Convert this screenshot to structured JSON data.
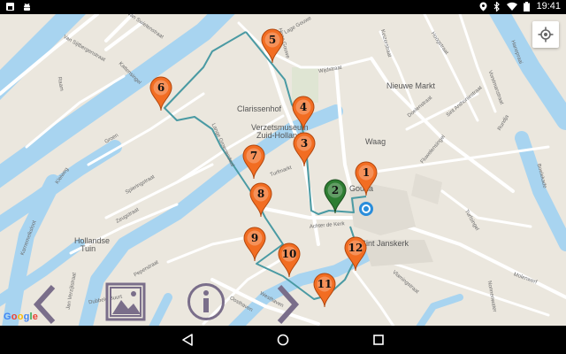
{
  "status_bar": {
    "time": "19:41",
    "icons": [
      "notification-icon",
      "android-icon",
      "location-icon",
      "bluetooth-icon",
      "wifi-icon",
      "battery-icon"
    ]
  },
  "map": {
    "labels": {
      "nieuwe_markt": "Nieuwe Markt",
      "clarissenhof": "Clarissenhof",
      "verzetsmuseum_1": "Verzetsmuseum",
      "verzetsmuseum_2": "Zuid-Holland",
      "waag": "Waag",
      "gouda": "Gouda",
      "sint_janskerk": "Sint Janskerk",
      "hollandse_1": "Hollandse",
      "hollandse_2": "Tuin",
      "van_swietenstraat": "Van Swietenstraat",
      "van_sijtbergenstraat": "Van Sijtbergenstraat",
      "kattensingel": "Kattensingel",
      "raam": "Raam",
      "groen": "Groen",
      "kleiweg": "Kleiweg",
      "lange_groenendaal": "Lange Groenendaal",
      "turfmarkt": "Turfmarkt",
      "hoge_gouwe": "Hoge Gouwe",
      "lage_gouwe": "Lage Gouwe",
      "achter_de_kerk": "Achter de Kerk",
      "spieringstraat": "Spieringstraat",
      "zeugstraat": "Zeugstraat",
      "peperstraat": "Peperstraat",
      "oosthaven": "Oosthaven",
      "westhaven": "Westhaven",
      "jan_verzijlstraat": "Jan Verzijlstraat",
      "dubbele_buurt": "Dubbele Buurt",
      "wijdstraat": "Wijdstraat",
      "regentesse": "Regentesseplantsoen",
      "walestraat": "Walestraat",
      "keizerstraat": "Keizerstraat",
      "hoogstraat": "Hoogstraat",
      "doelenstraat": "Doelenstraat",
      "sint_anthonie": "Sint Anthoniestraat",
      "vorstmanstraat": "Vorstmanstraat",
      "hanepraai": "Hanepraai",
      "boelekade": "Boelekade",
      "fluwelensingel": "Fluwelensingel",
      "turfsingel": "Turfsingel",
      "vlamingstraat": "Vlamingstraat",
      "nonnenwater": "Nonnenwater",
      "molenwerf": "Molenwerf",
      "karnemelksloot": "Karnemelksloot",
      "agnietenstraat": "Agnietenstraat",
      "gouwe": "Gouwe",
      "goudse_hout": "Houtmansgracht",
      "rundja": "Rundja",
      "kuiperstraat": "Kuiperstraat",
      "markt": "Markt",
      "lange_tiendeweg": "Lange Tiendeweg",
      "geuzenstraat": "Geuzenstraat",
      "zakkendragerssteeg": "Zakkendragerssteeg",
      "hoge_gouwe_2": "Hoge Gouwe",
      "buurtje": "Buurtje",
      "kleiwegstraat": "Kleiwegstraat"
    },
    "markers": [
      {
        "num": "1",
        "color": "#f26d22"
      },
      {
        "num": "2",
        "color": "#2e7d32"
      },
      {
        "num": "3",
        "color": "#f26d22"
      },
      {
        "num": "4",
        "color": "#f26d22"
      },
      {
        "num": "5",
        "color": "#f26d22"
      },
      {
        "num": "6",
        "color": "#f26d22"
      },
      {
        "num": "7",
        "color": "#f26d22"
      },
      {
        "num": "8",
        "color": "#f26d22"
      },
      {
        "num": "9",
        "color": "#f26d22"
      },
      {
        "num": "10",
        "color": "#f26d22"
      },
      {
        "num": "11",
        "color": "#f26d22"
      },
      {
        "num": "12",
        "color": "#f26d22"
      }
    ],
    "route_color": "#4a9aa3",
    "water_color": "#a8d4f0",
    "road_color": "#ffffff",
    "attribution": "Google"
  },
  "controls": {
    "prev": "previous-icon",
    "gallery": "image-gallery-icon",
    "info": "info-icon",
    "next": "next-icon",
    "color": "#7a6e8a"
  },
  "nav_bar": {
    "buttons": [
      "back-icon",
      "home-icon",
      "recents-icon"
    ]
  }
}
